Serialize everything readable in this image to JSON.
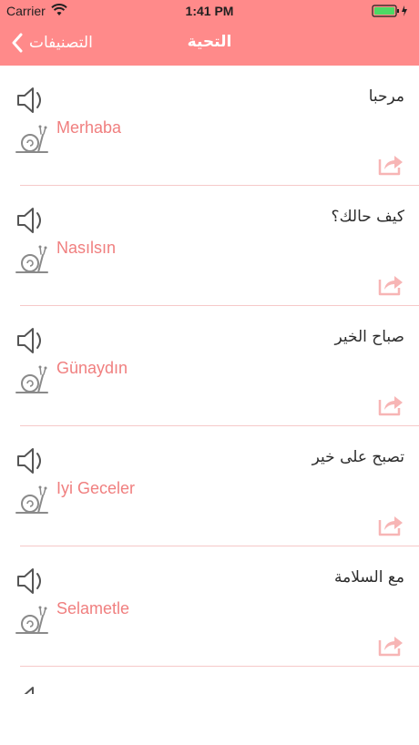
{
  "status_bar": {
    "carrier": "Carrier",
    "time": "1:41 PM",
    "battery_color": "#4cd964"
  },
  "nav": {
    "back_label": "التصنيفات",
    "title": "التحية",
    "bar_color": "#ff8a8a"
  },
  "phrases": [
    {
      "arabic": "مرحبا",
      "turkish": "Merhaba"
    },
    {
      "arabic": "كيف حالك؟",
      "turkish": "Nasılsın"
    },
    {
      "arabic": "صباح الخير",
      "turkish": "Günaydın"
    },
    {
      "arabic": "تصبح على خير",
      "turkish": "Iyi Geceler"
    },
    {
      "arabic": "مع السلامة",
      "turkish": "Selametle"
    }
  ],
  "icons": {
    "speaker": "speaker-icon",
    "slow": "snail-icon",
    "share": "share-icon",
    "back": "chevron-left-icon"
  }
}
